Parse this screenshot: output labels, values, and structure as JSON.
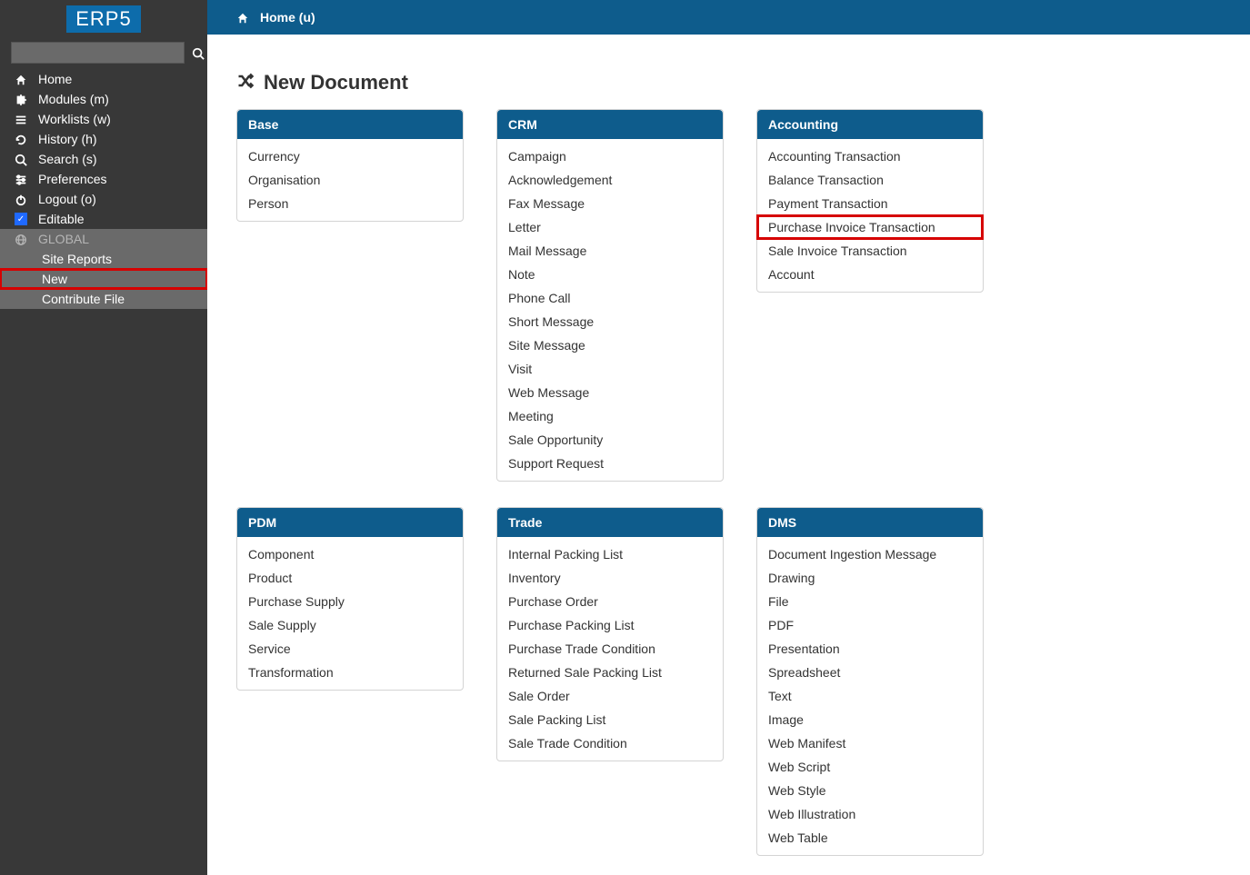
{
  "brand": "ERP5",
  "topbar": {
    "label": "Home (u)"
  },
  "sidebar": {
    "search_placeholder": "",
    "items": [
      {
        "icon": "home",
        "label": "Home"
      },
      {
        "icon": "puzzle",
        "label": "Modules (m)"
      },
      {
        "icon": "list",
        "label": "Worklists (w)"
      },
      {
        "icon": "history",
        "label": "History (h)"
      },
      {
        "icon": "search",
        "label": "Search (s)"
      },
      {
        "icon": "sliders",
        "label": "Preferences"
      },
      {
        "icon": "power",
        "label": "Logout (o)"
      }
    ],
    "editable_label": "Editable",
    "global_label": "GLOBAL",
    "sub_items": [
      {
        "label": "Site Reports"
      },
      {
        "label": "New",
        "highlight": true
      },
      {
        "label": "Contribute File"
      }
    ]
  },
  "page": {
    "title": "New Document"
  },
  "cards": [
    {
      "title": "Base",
      "items": [
        "Currency",
        "Organisation",
        "Person"
      ]
    },
    {
      "title": "CRM",
      "items": [
        "Campaign",
        "Acknowledgement",
        "Fax Message",
        "Letter",
        "Mail Message",
        "Note",
        "Phone Call",
        "Short Message",
        "Site Message",
        "Visit",
        "Web Message",
        "Meeting",
        "Sale Opportunity",
        "Support Request"
      ]
    },
    {
      "title": "Accounting",
      "items": [
        "Accounting Transaction",
        "Balance Transaction",
        "Payment Transaction",
        "Purchase Invoice Transaction",
        "Sale Invoice Transaction",
        "Account"
      ],
      "highlight_index": 3
    },
    {
      "title": "PDM",
      "items": [
        "Component",
        "Product",
        "Purchase Supply",
        "Sale Supply",
        "Service",
        "Transformation"
      ]
    },
    {
      "title": "Trade",
      "items": [
        "Internal Packing List",
        "Inventory",
        "Purchase Order",
        "Purchase Packing List",
        "Purchase Trade Condition",
        "Returned Sale Packing List",
        "Sale Order",
        "Sale Packing List",
        "Sale Trade Condition"
      ]
    },
    {
      "title": "DMS",
      "items": [
        "Document Ingestion Message",
        "Drawing",
        "File",
        "PDF",
        "Presentation",
        "Spreadsheet",
        "Text",
        "Image",
        "Web Manifest",
        "Web Script",
        "Web Style",
        "Web Illustration",
        "Web Table"
      ]
    }
  ],
  "icons": {
    "home": "⌂",
    "puzzle": "✚",
    "list": "☰",
    "history": "↺",
    "search": "🔍",
    "sliders": "≡",
    "power": "⏻",
    "globe": "🌐",
    "shuffle": "⇄"
  }
}
